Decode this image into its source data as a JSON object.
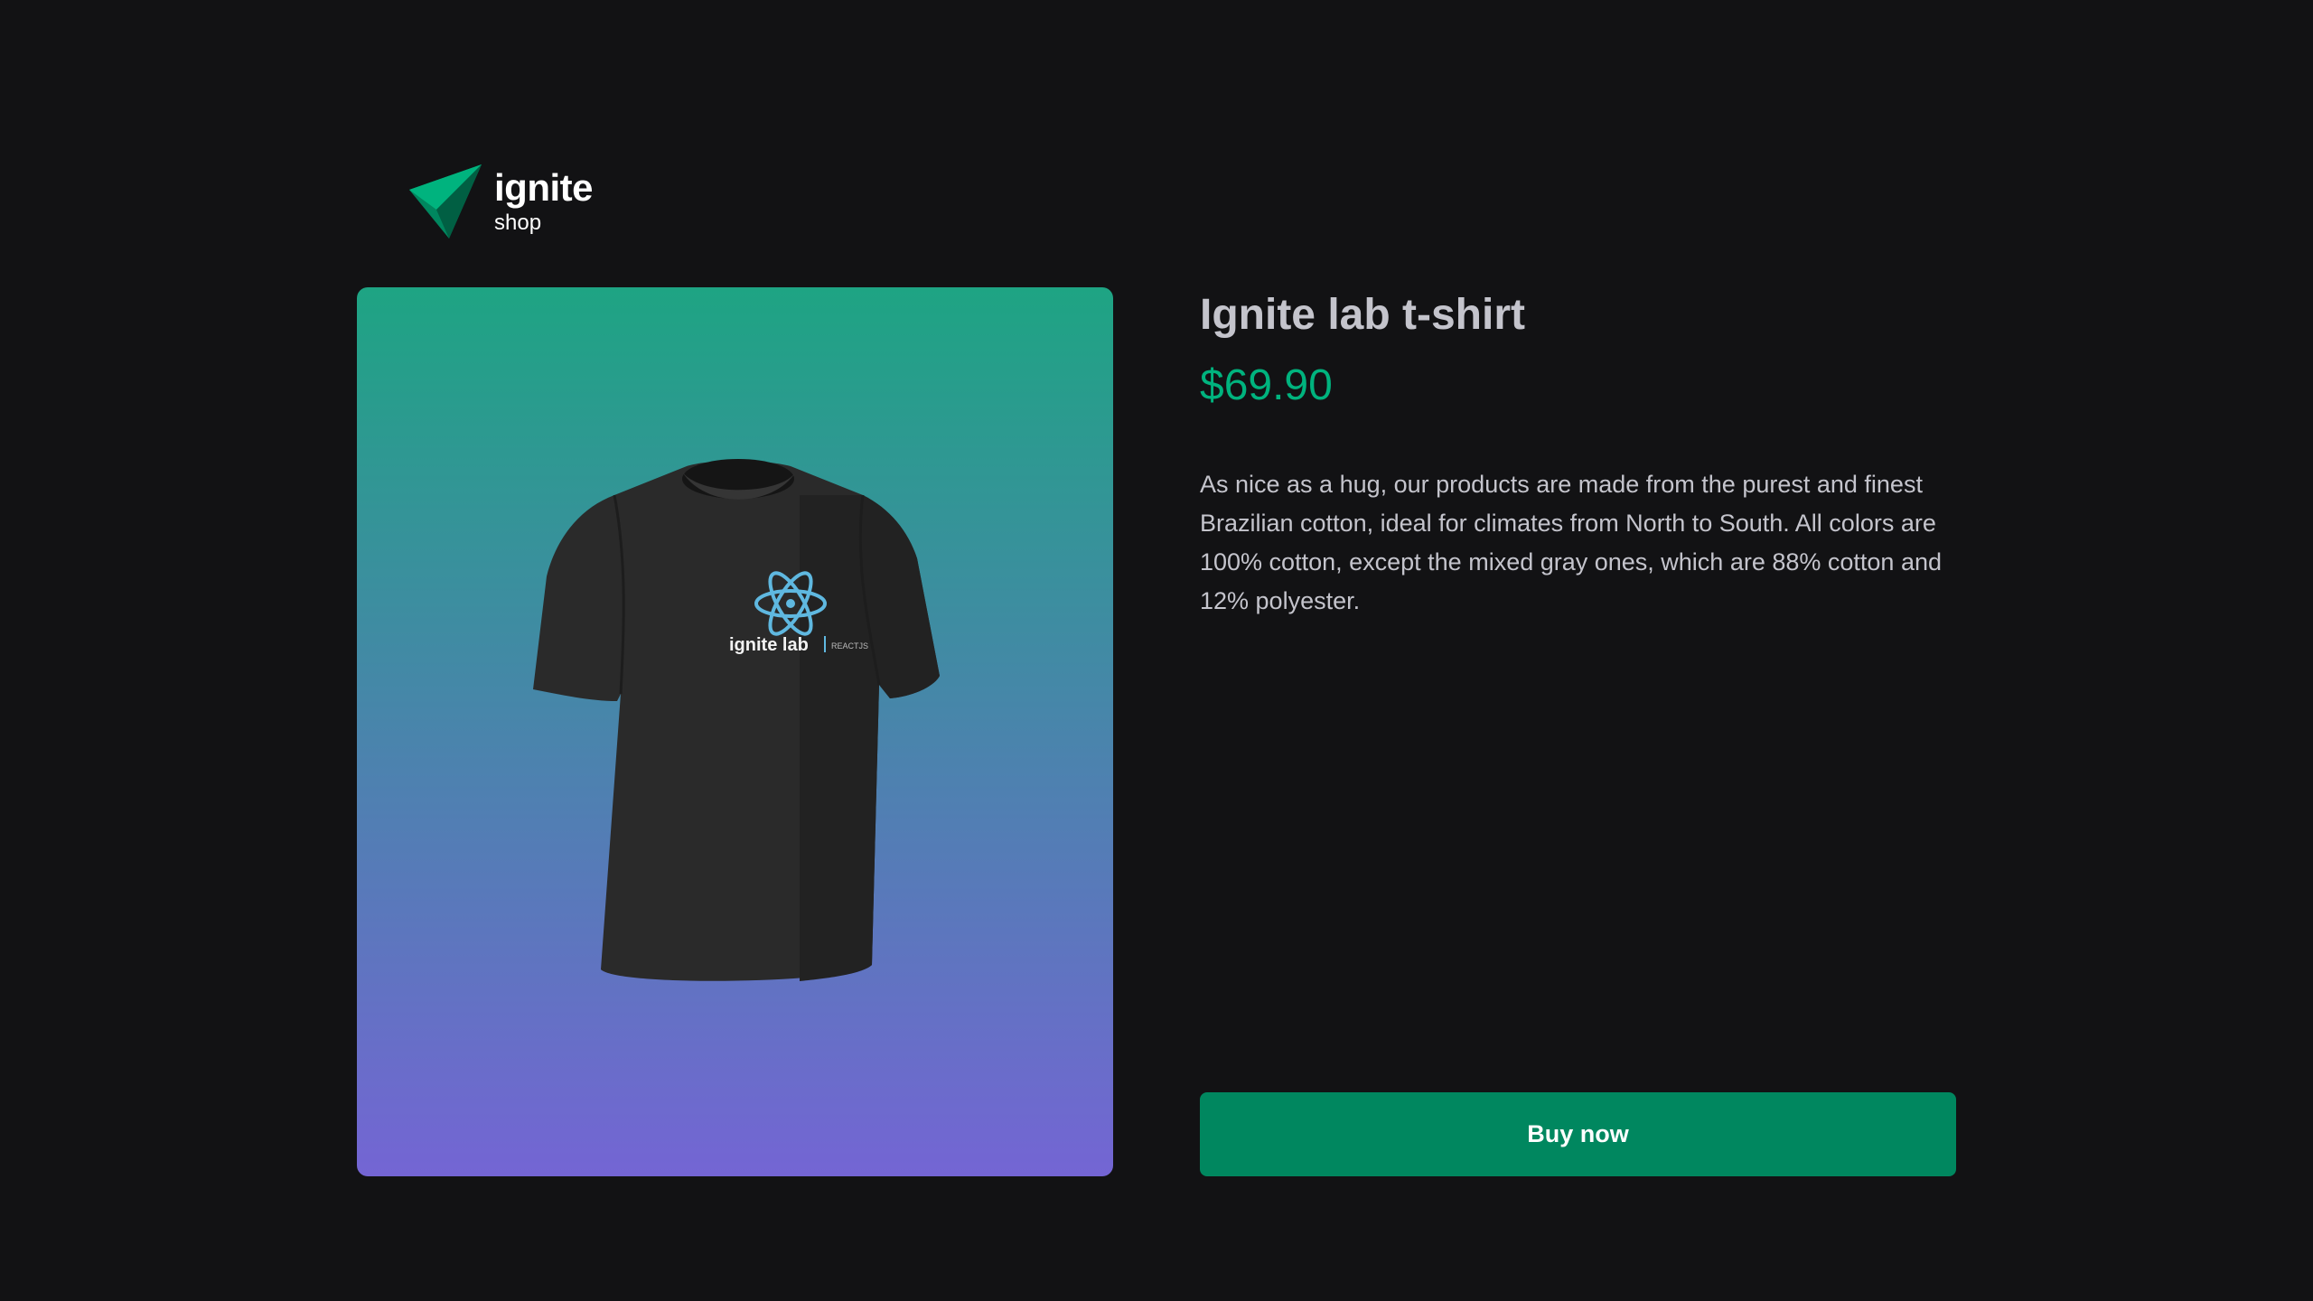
{
  "brand": {
    "name": "ignite",
    "subtitle": "shop",
    "logo_icon": "paper-plane-logo-icon",
    "accent": "#00875f"
  },
  "product": {
    "image_icon": "tshirt-image",
    "image_gradient": [
      "#1ea483",
      "#7465d4"
    ],
    "title": "Ignite lab t-shirt",
    "price": "$69.90",
    "description": "As nice as a hug, our products are made from the purest and finest Brazilian cotton, ideal for climates from North to South. All colors are 100% cotton, except the mixed gray ones, which are 88% cotton and 12% polyester.",
    "shirt_print": "ignite lab",
    "shirt_print_tag": "REACTJS"
  },
  "actions": {
    "buy_label": "Buy now"
  },
  "colors": {
    "background": "#121214",
    "price": "#00b37e",
    "button": "#00875f",
    "title": "#c4c4cc"
  }
}
